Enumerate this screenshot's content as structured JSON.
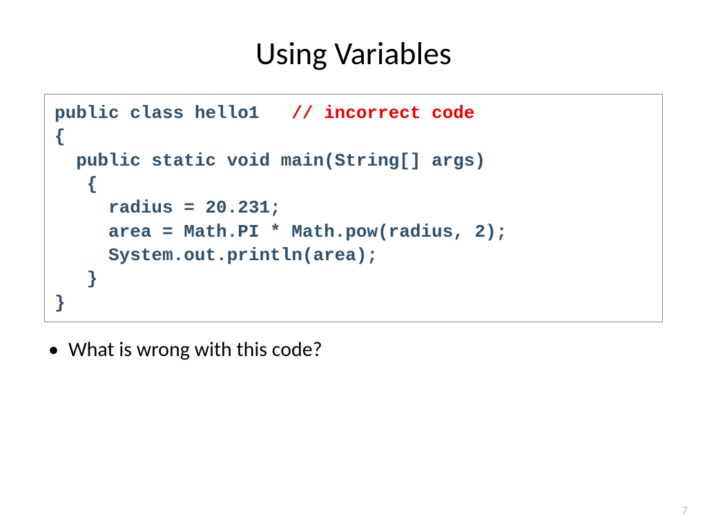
{
  "title": "Using Variables",
  "code": {
    "line1_code": "public class hello1   ",
    "line1_comment": "// incorrect code",
    "line2": "{",
    "line3": "  public static void main(String[] args)",
    "line4": "   {",
    "line5": "     radius = 20.231;",
    "line6": "     area = Math.PI * Math.pow(radius, 2);",
    "line7": "     System.out.println(area);",
    "line8": "   }",
    "line9": "}"
  },
  "bullet": "What is wrong with this code?",
  "page_number": "7"
}
